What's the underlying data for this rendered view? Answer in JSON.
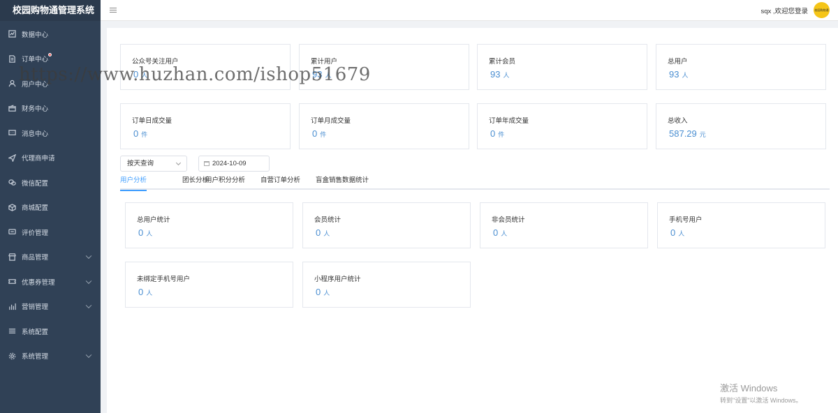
{
  "app": {
    "title": "校园购物通管理系统"
  },
  "sidebar": {
    "items": [
      {
        "label": "数据中心",
        "icon": "chart-icon"
      },
      {
        "label": "订单中心",
        "icon": "document-icon",
        "badge": true
      },
      {
        "label": "用户中心",
        "icon": "user-icon"
      },
      {
        "label": "财务中心",
        "icon": "wallet-icon"
      },
      {
        "label": "消息中心",
        "icon": "message-icon"
      },
      {
        "label": "代理商申请",
        "icon": "send-icon"
      },
      {
        "label": "微信配置",
        "icon": "wechat-icon"
      },
      {
        "label": "商城配置",
        "icon": "box-icon"
      },
      {
        "label": "评价管理",
        "icon": "comment-icon"
      },
      {
        "label": "商品管理",
        "icon": "store-icon",
        "expandable": true
      },
      {
        "label": "优惠券管理",
        "icon": "coupon-icon",
        "expandable": true
      },
      {
        "label": "营销管理",
        "icon": "bar-chart-icon",
        "expandable": true
      },
      {
        "label": "系统配置",
        "icon": "list-icon"
      },
      {
        "label": "系统管理",
        "icon": "gear-icon",
        "expandable": true
      }
    ]
  },
  "header": {
    "user_text": "sqx ,欢迎您登录",
    "avatar_text": "校园购物通"
  },
  "stats_top": [
    {
      "title": "公众号关注用户",
      "value": "0",
      "unit": "人"
    },
    {
      "title": "累计用户",
      "value": "93",
      "unit": "人"
    },
    {
      "title": "累计会员",
      "value": "93",
      "unit": "人"
    },
    {
      "title": "总用户",
      "value": "93",
      "unit": "人"
    },
    {
      "title": "订单日成交量",
      "value": "0",
      "unit": "件"
    },
    {
      "title": "订单月成交量",
      "value": "0",
      "unit": "件"
    },
    {
      "title": "订单年成交量",
      "value": "0",
      "unit": "件"
    },
    {
      "title": "总收入",
      "value": "587.29",
      "unit": "元"
    }
  ],
  "filter": {
    "query_mode": "按天查询",
    "date": "2024-10-09"
  },
  "tabs": [
    {
      "label": "用户分析",
      "active": true
    },
    {
      "label": "团长分析"
    },
    {
      "label": "用户积分分析"
    },
    {
      "label": "自营订单分析"
    },
    {
      "label": "盲盒销售数据统计"
    }
  ],
  "stats_users": [
    {
      "title": "总用户统计",
      "value": "0",
      "unit": "人"
    },
    {
      "title": "会员统计",
      "value": "0",
      "unit": "人"
    },
    {
      "title": "非会员统计",
      "value": "0",
      "unit": "人"
    },
    {
      "title": "手机号用户",
      "value": "0",
      "unit": "人"
    },
    {
      "title": "未绑定手机号用户",
      "value": "0",
      "unit": "人"
    },
    {
      "title": "小程序用户统计",
      "value": "0",
      "unit": "人"
    }
  ],
  "watermark": {
    "url": "https://www.huzhan.com/ishop51679",
    "windows_line1": "激活 Windows",
    "windows_line2": "转到\"设置\"以激活 Windows。"
  },
  "colors": {
    "sidebar_bg": "#304156",
    "accent": "#409eff",
    "value": "#4a8ed1"
  }
}
